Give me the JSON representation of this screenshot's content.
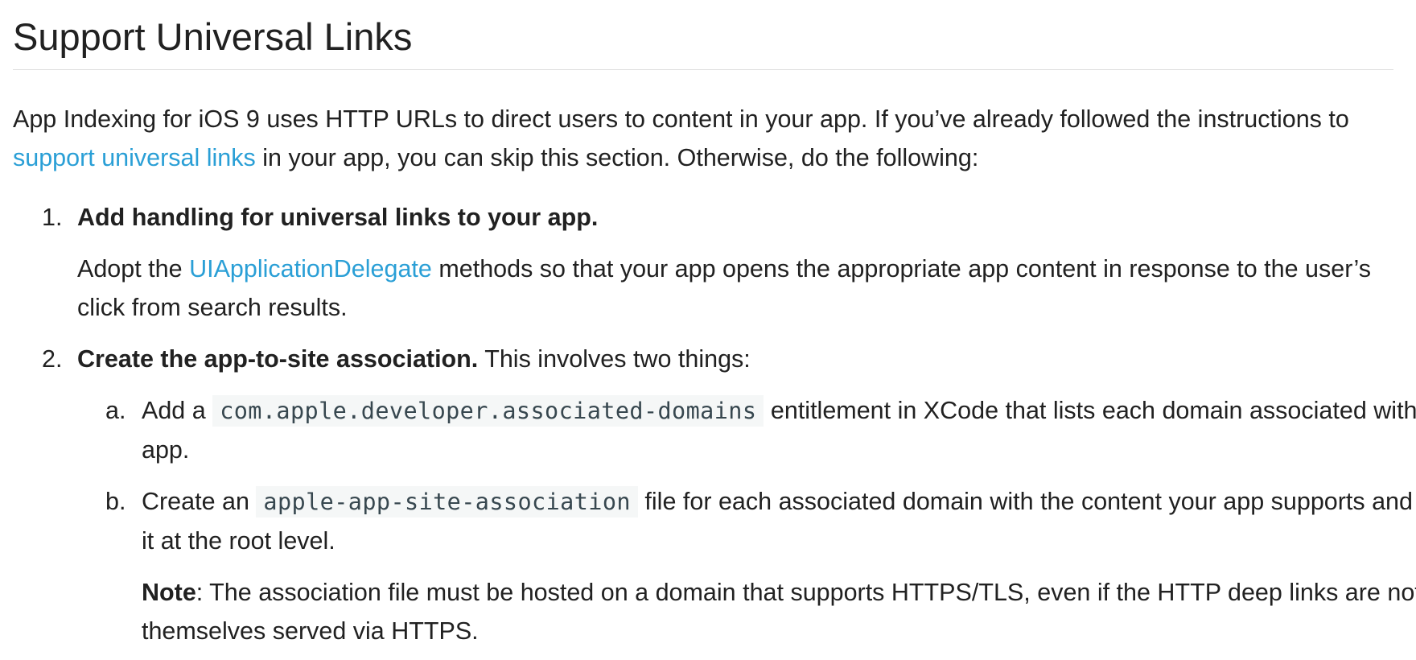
{
  "heading": "Support Universal Links",
  "intro": {
    "before_link": "App Indexing for iOS 9 uses HTTP URLs to direct users to content in your app. If you’ve already followed the instructions to ",
    "link_text": "support universal links",
    "after_link": " in your app, you can skip this section. Otherwise, do the following:"
  },
  "steps": [
    {
      "marker": "1.",
      "title": "Add handling for universal links to your app.",
      "body_before_link": "Adopt the ",
      "body_link": "UIApplicationDelegate",
      "body_after_link": " methods so that your app opens the appropriate app content in response to the user’s click from search results."
    },
    {
      "marker": "2.",
      "title": "Create the app-to-site association.",
      "title_suffix": " This involves two things:",
      "substeps": [
        {
          "marker": "a.",
          "before_code": "Add a ",
          "code": "com.apple.developer.associated-domains",
          "after_code": " entitlement in XCode that lists each domain associated with your app."
        },
        {
          "marker": "b.",
          "before_code": "Create an ",
          "code": "apple-app-site-association",
          "after_code": " file for each associated domain with the content your app supports and host it at the root level.",
          "note_label": "Note",
          "note_text": ": The association file must be hosted on a domain that supports HTTPS/TLS, even if the HTTP deep links are not themselves served via HTTPS."
        }
      ]
    }
  ],
  "colors": {
    "link": "#2a9fd6",
    "text": "#212121",
    "code_bg": "#f5f7f7",
    "code_text": "#37474f",
    "rule": "#e0e0e0"
  }
}
